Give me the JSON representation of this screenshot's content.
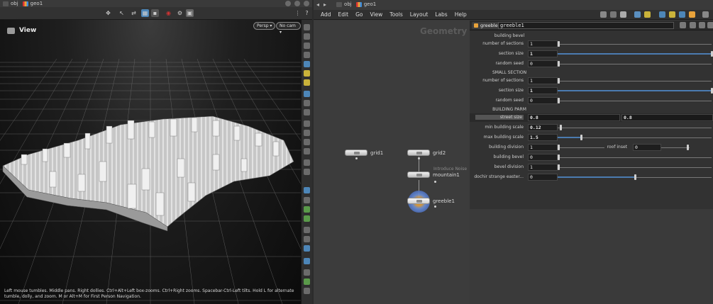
{
  "left_panel": {
    "path": {
      "root": "obj",
      "node": "geo1"
    },
    "viewport": {
      "title": "View",
      "camera_mode": "Persp ▾",
      "camera_select": "No cam ▾",
      "help_text": "Left mouse tumbles. Middle pans. Right dollies. Ctrl+Alt+Left box-zooms. Ctrl+Right zooms. Spacebar-Ctrl-Left tilts. Hold L for alternate tumble, dolly, and zoom. M or Alt+M for First Person Navigation."
    }
  },
  "right_panel": {
    "path": {
      "root": "obj",
      "node": "geo1"
    },
    "menu": [
      "Add",
      "Edit",
      "Go",
      "View",
      "Tools",
      "Layout",
      "Labs",
      "Help"
    ],
    "network": {
      "context_label": "Geometry",
      "nodes": [
        {
          "name": "grid1"
        },
        {
          "name": "grid2"
        },
        {
          "name": "mountain1",
          "comment": "Introduce Noise"
        },
        {
          "name": "greeble1"
        }
      ]
    },
    "params": {
      "node_type": "greeble",
      "node_name": "greeble1",
      "building_bevel_header": "building bevel",
      "small_section_header": "SMALL SECTION",
      "building_parm_header": "BUILDING PARM",
      "rows": {
        "bevel_sections": {
          "label": "number of sections",
          "value": "1"
        },
        "bevel_size": {
          "label": "section size",
          "value": "1"
        },
        "bevel_seed": {
          "label": "random seed",
          "value": "0"
        },
        "small_sections": {
          "label": "number of sections",
          "value": "1"
        },
        "small_size": {
          "label": "section size",
          "value": "1"
        },
        "small_seed": {
          "label": "random seed",
          "value": "0"
        },
        "street_size": {
          "label": "street size",
          "value1": "0.8",
          "value2": "0.8"
        },
        "min_scale": {
          "label": "min building scale",
          "value": "0.12"
        },
        "max_scale": {
          "label": "max building scale",
          "value": "1.5"
        },
        "division": {
          "label": "building division",
          "value": "1",
          "roof_label": "roof inset",
          "roof_value": "0"
        },
        "building_bevel": {
          "label": "building bevel",
          "value": "0"
        },
        "bevel_division": {
          "label": "bevel division",
          "value": "1"
        },
        "easter": {
          "label": "dochir strange easter...",
          "value": "0"
        }
      }
    }
  },
  "colors": {
    "accent": "#4b7bb0",
    "node_selected": "#3a6cc0",
    "node_display": "#e8a23a"
  },
  "icons": [
    "camera-icon",
    "geometry-icon",
    "back-arrow-icon",
    "forward-arrow-icon",
    "gear-icon",
    "search-icon",
    "help-icon"
  ]
}
